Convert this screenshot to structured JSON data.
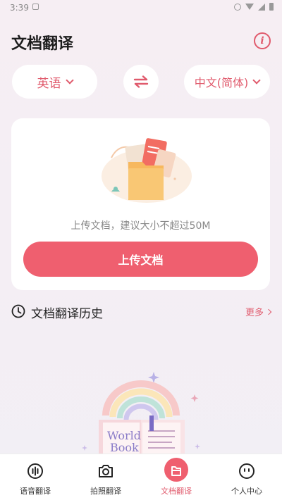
{
  "status_bar": {
    "time": "3:39"
  },
  "header": {
    "title": "文档翻译",
    "info_label": "i"
  },
  "languages": {
    "source": "英语",
    "target": "中文(简体)"
  },
  "upload": {
    "hint": "上传文档，建议大小不超过50M",
    "button_label": "上传文档"
  },
  "history": {
    "title": "文档翻译历史",
    "more_label": "更多"
  },
  "illustration": {
    "book_text_1": "World",
    "book_text_2": "Book"
  },
  "tabs": [
    {
      "label": "语音翻译",
      "icon": "voice-wave-icon",
      "active": false
    },
    {
      "label": "拍照翻译",
      "icon": "camera-icon",
      "active": false
    },
    {
      "label": "文档翻译",
      "icon": "folder-icon",
      "active": true
    },
    {
      "label": "个人中心",
      "icon": "smiley-face-icon",
      "active": false
    }
  ],
  "colors": {
    "accent": "#ef5f6f",
    "accent_text": "#e05a6c"
  }
}
